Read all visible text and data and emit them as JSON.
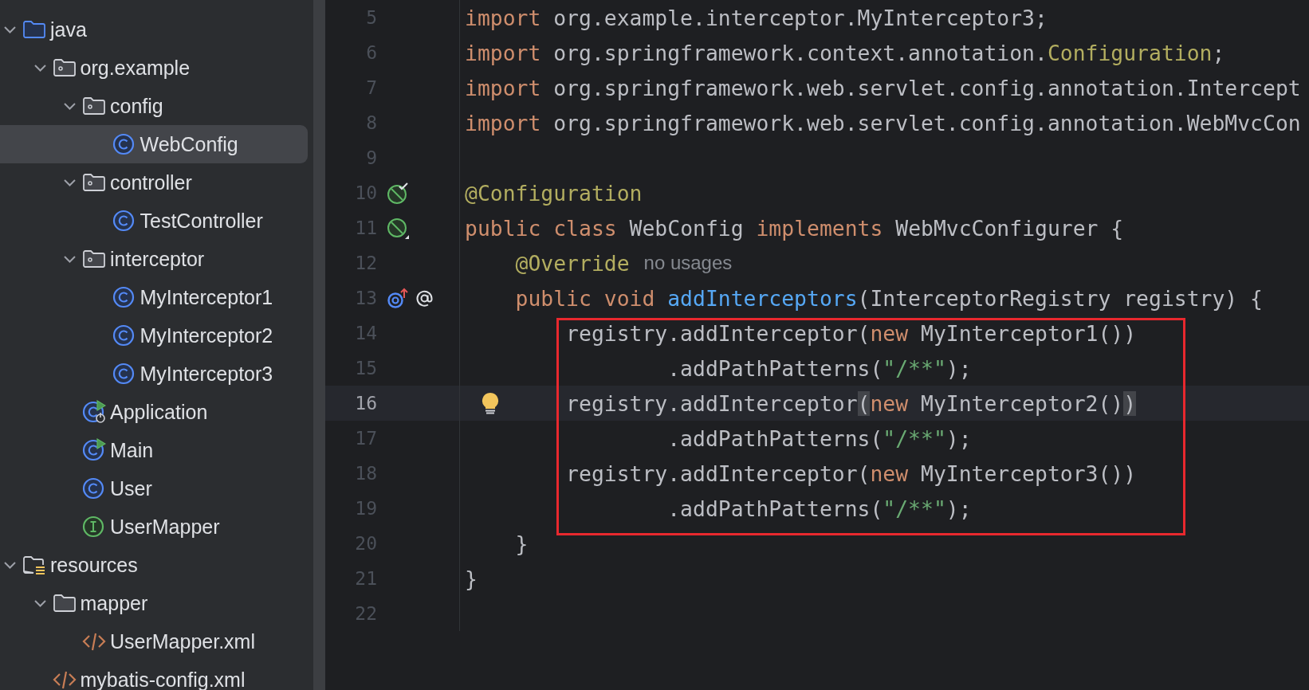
{
  "tree": [
    {
      "label": "java",
      "kind": "source-folder",
      "expanded": true,
      "selected": false,
      "children": [
        {
          "label": "org.example",
          "kind": "package",
          "expanded": true,
          "selected": false,
          "children": [
            {
              "label": "config",
              "kind": "package",
              "expanded": true,
              "selected": false,
              "children": [
                {
                  "label": "WebConfig",
                  "kind": "class",
                  "selected": true
                }
              ]
            },
            {
              "label": "controller",
              "kind": "package",
              "expanded": true,
              "selected": false,
              "children": [
                {
                  "label": "TestController",
                  "kind": "class",
                  "selected": false
                }
              ]
            },
            {
              "label": "interceptor",
              "kind": "package",
              "expanded": true,
              "selected": false,
              "children": [
                {
                  "label": "MyInterceptor1",
                  "kind": "class",
                  "selected": false
                },
                {
                  "label": "MyInterceptor2",
                  "kind": "class",
                  "selected": false
                },
                {
                  "label": "MyInterceptor3",
                  "kind": "class",
                  "selected": false
                }
              ]
            },
            {
              "label": "Application",
              "kind": "app-class",
              "selected": false
            },
            {
              "label": "Main",
              "kind": "run-class",
              "selected": false
            },
            {
              "label": "User",
              "kind": "class",
              "selected": false
            },
            {
              "label": "UserMapper",
              "kind": "interface",
              "selected": false
            }
          ]
        }
      ]
    },
    {
      "label": "resources",
      "kind": "resources-folder",
      "expanded": true,
      "selected": false,
      "children": [
        {
          "label": "mapper",
          "kind": "folder",
          "expanded": true,
          "selected": false,
          "children": [
            {
              "label": "UserMapper.xml",
              "kind": "xml",
              "selected": false
            }
          ]
        },
        {
          "label": "mybatis-config.xml",
          "kind": "xml",
          "selected": false
        }
      ]
    }
  ],
  "lines": [
    {
      "number": "5",
      "current": false,
      "boxed": false,
      "bulb": false,
      "tokens": [
        {
          "text": "import",
          "kind": "keyword"
        },
        {
          "text": " org.example.interceptor.MyInterceptor3;",
          "kind": "plain"
        }
      ]
    },
    {
      "number": "6",
      "current": false,
      "boxed": false,
      "bulb": false,
      "tokens": [
        {
          "text": "import",
          "kind": "keyword"
        },
        {
          "text": " org.springframework.context.annotation.",
          "kind": "plain"
        },
        {
          "text": "Configuration",
          "kind": "annotation"
        },
        {
          "text": ";",
          "kind": "plain"
        }
      ]
    },
    {
      "number": "7",
      "current": false,
      "boxed": false,
      "bulb": false,
      "tokens": [
        {
          "text": "import",
          "kind": "keyword"
        },
        {
          "text": " org.springframework.web.servlet.config.annotation.Intercept",
          "kind": "plain"
        }
      ]
    },
    {
      "number": "8",
      "current": false,
      "boxed": false,
      "bulb": false,
      "tokens": [
        {
          "text": "import",
          "kind": "keyword"
        },
        {
          "text": " org.springframework.web.servlet.config.annotation.WebMvcCon",
          "kind": "plain"
        }
      ]
    },
    {
      "number": "9",
      "current": false,
      "boxed": false,
      "bulb": false
    },
    {
      "number": "10",
      "current": false,
      "boxed": false,
      "bulb": false,
      "gutter_icons": [
        {
          "kind": "bean-check"
        }
      ],
      "tokens": [
        {
          "text": "@Configuration",
          "kind": "annotation"
        }
      ]
    },
    {
      "number": "11",
      "current": false,
      "boxed": false,
      "bulb": false,
      "gutter_icons": [
        {
          "kind": "bean"
        }
      ],
      "tokens": [
        {
          "text": "public",
          "kind": "keyword"
        },
        {
          "text": " class",
          "kind": "keyword"
        },
        {
          "text": " WebConfig ",
          "kind": "plain"
        },
        {
          "text": "implements",
          "kind": "keyword"
        },
        {
          "text": " WebMvcConfigurer {",
          "kind": "plain"
        }
      ]
    },
    {
      "number": "12",
      "current": false,
      "boxed": false,
      "bulb": false,
      "tokens": [
        {
          "text": "    @Override",
          "kind": "annotation"
        }
      ],
      "hint": "no usages"
    },
    {
      "number": "13",
      "current": false,
      "boxed": false,
      "bulb": false,
      "gutter_icons": [
        {
          "kind": "override"
        },
        {
          "kind": "at"
        }
      ],
      "tokens": [
        {
          "text": "    public",
          "kind": "keyword"
        },
        {
          "text": " void",
          "kind": "keyword"
        },
        {
          "text": " addInterceptors",
          "kind": "method"
        },
        {
          "text": "(InterceptorRegistry registry) {",
          "kind": "plain"
        }
      ]
    },
    {
      "number": "14",
      "current": false,
      "boxed": true,
      "bulb": false,
      "tokens": [
        {
          "text": "        registry.addInterceptor(",
          "kind": "plain"
        },
        {
          "text": "new",
          "kind": "keyword"
        },
        {
          "text": " MyInterceptor1())",
          "kind": "plain"
        }
      ]
    },
    {
      "number": "15",
      "current": false,
      "boxed": true,
      "bulb": false,
      "tokens": [
        {
          "text": "                .addPathPatterns(",
          "kind": "plain"
        },
        {
          "text": "\"/**\"",
          "kind": "string"
        },
        {
          "text": ");",
          "kind": "plain"
        }
      ]
    },
    {
      "number": "16",
      "current": true,
      "boxed": true,
      "bulb": true,
      "tokens": [
        {
          "text": "        registry.addInterceptor",
          "kind": "plain"
        },
        {
          "text": "(",
          "kind": "paren-match"
        },
        {
          "text": "new",
          "kind": "keyword"
        },
        {
          "text": " MyInterceptor2()",
          "kind": "plain"
        },
        {
          "text": ")",
          "kind": "paren-match"
        }
      ]
    },
    {
      "number": "17",
      "current": false,
      "boxed": true,
      "bulb": false,
      "tokens": [
        {
          "text": "                .addPathPatterns(",
          "kind": "plain"
        },
        {
          "text": "\"/**\"",
          "kind": "string"
        },
        {
          "text": ");",
          "kind": "plain"
        }
      ]
    },
    {
      "number": "18",
      "current": false,
      "boxed": true,
      "bulb": false,
      "tokens": [
        {
          "text": "        registry.addInterceptor(",
          "kind": "plain"
        },
        {
          "text": "new",
          "kind": "keyword"
        },
        {
          "text": " MyInterceptor3())",
          "kind": "plain"
        }
      ]
    },
    {
      "number": "19",
      "current": false,
      "boxed": true,
      "bulb": false,
      "tokens": [
        {
          "text": "                .addPathPatterns(",
          "kind": "plain"
        },
        {
          "text": "\"/**\"",
          "kind": "string"
        },
        {
          "text": ");",
          "kind": "plain"
        }
      ]
    },
    {
      "number": "20",
      "current": false,
      "boxed": false,
      "bulb": false,
      "tokens": [
        {
          "text": "    }",
          "kind": "plain"
        }
      ]
    },
    {
      "number": "21",
      "current": false,
      "boxed": false,
      "bulb": false,
      "tokens": [
        {
          "text": "}",
          "kind": "plain"
        }
      ]
    },
    {
      "number": "22",
      "current": false,
      "boxed": false,
      "bulb": false
    }
  ]
}
